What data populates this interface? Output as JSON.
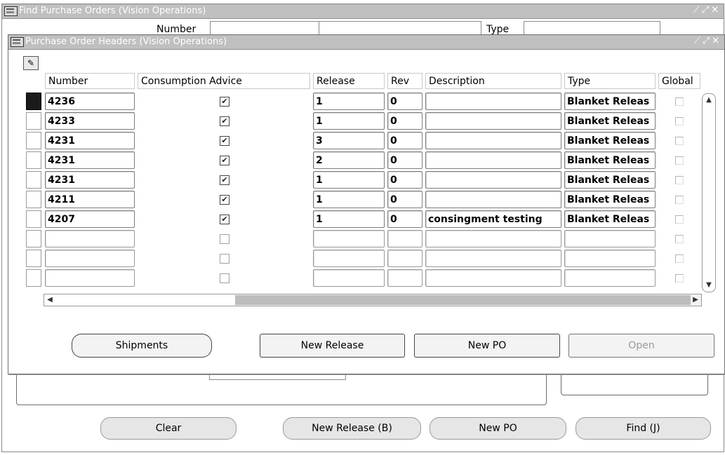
{
  "find_window": {
    "title": "Find Purchase Orders (Vision Operations)",
    "number_label": "Number",
    "type_label": "Type",
    "buttons": {
      "clear_label": "Clear",
      "new_release_label": "New Release (B)",
      "new_po_label": "New PO",
      "find_label": "Find (J)"
    }
  },
  "po_window": {
    "title": "Purchase Order Headers (Vision Operations)",
    "columns": [
      "Number",
      "Consumption Advice",
      "Release",
      "Rev",
      "Description",
      "Type",
      "Global"
    ],
    "rows": [
      {
        "number": "4236",
        "consumption_advice": true,
        "release": "1",
        "rev": "0",
        "description": "",
        "type": "Blanket Releas",
        "global": false,
        "current": true
      },
      {
        "number": "4233",
        "consumption_advice": true,
        "release": "1",
        "rev": "0",
        "description": "",
        "type": "Blanket Releas",
        "global": false,
        "current": false
      },
      {
        "number": "4231",
        "consumption_advice": true,
        "release": "3",
        "rev": "0",
        "description": "",
        "type": "Blanket Releas",
        "global": false,
        "current": false
      },
      {
        "number": "4231",
        "consumption_advice": true,
        "release": "2",
        "rev": "0",
        "description": "",
        "type": "Blanket Releas",
        "global": false,
        "current": false
      },
      {
        "number": "4231",
        "consumption_advice": true,
        "release": "1",
        "rev": "0",
        "description": "",
        "type": "Blanket Releas",
        "global": false,
        "current": false
      },
      {
        "number": "4211",
        "consumption_advice": true,
        "release": "1",
        "rev": "0",
        "description": "",
        "type": "Blanket Releas",
        "global": false,
        "current": false
      },
      {
        "number": "4207",
        "consumption_advice": true,
        "release": "1",
        "rev": "0",
        "description": "consingment testing",
        "type": "Blanket Releas",
        "global": false,
        "current": false
      },
      {
        "number": "",
        "consumption_advice": false,
        "release": "",
        "rev": "",
        "description": "",
        "type": "",
        "global": false,
        "current": false
      },
      {
        "number": "",
        "consumption_advice": false,
        "release": "",
        "rev": "",
        "description": "",
        "type": "",
        "global": false,
        "current": false
      },
      {
        "number": "",
        "consumption_advice": false,
        "release": "",
        "rev": "",
        "description": "",
        "type": "",
        "global": false,
        "current": false
      }
    ],
    "buttons": {
      "shipments_label": "Shipments",
      "new_release_label": "New Release",
      "new_po_label": "New PO",
      "open_label": "Open"
    }
  },
  "icons": {
    "window_icon": "window-icon",
    "toolbar_icon": "folder-tools-icon",
    "minimize": "minimize-icon",
    "maximize": "maximize-icon",
    "close": "close-icon"
  }
}
